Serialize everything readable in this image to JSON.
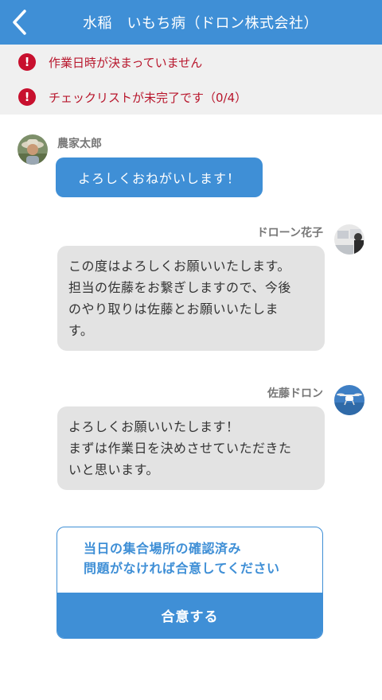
{
  "header": {
    "title": "水稲　いもち病（ドロン株式会社）",
    "back_icon": "chevron-left-icon"
  },
  "alerts": [
    {
      "icon": "error-icon",
      "symbol": "!",
      "text": "作業日時が決まっていません"
    },
    {
      "icon": "error-icon",
      "symbol": "!",
      "text": "チェックリストが未完了です（0/4）"
    }
  ],
  "messages": [
    {
      "sender": "農家太郎",
      "side": "left",
      "lines": [
        "よろしくおねがいします！"
      ]
    },
    {
      "sender": "ドローン花子",
      "side": "right",
      "lines": [
        "この度はよろしくお願いいたします。",
        "担当の佐藤をお繋ぎしますので、今後",
        "のやり取りは佐藤とお願いいたしま",
        "す。"
      ]
    },
    {
      "sender": "佐藤ドロン",
      "side": "right",
      "lines": [
        "よろしくお願いいたします！",
        "まずは作業日を決めさせていただきた",
        "いと思います。"
      ]
    }
  ],
  "confirm": {
    "lines": [
      "当日の集合場所の確認済み",
      "問題がなければ合意してください"
    ],
    "button_label": "合意する"
  },
  "colors": {
    "accent": "#3f8fd6",
    "alert_red": "#c8102e",
    "bubble_gray": "#e3e3e3",
    "alert_bg": "#f0f0f0"
  }
}
